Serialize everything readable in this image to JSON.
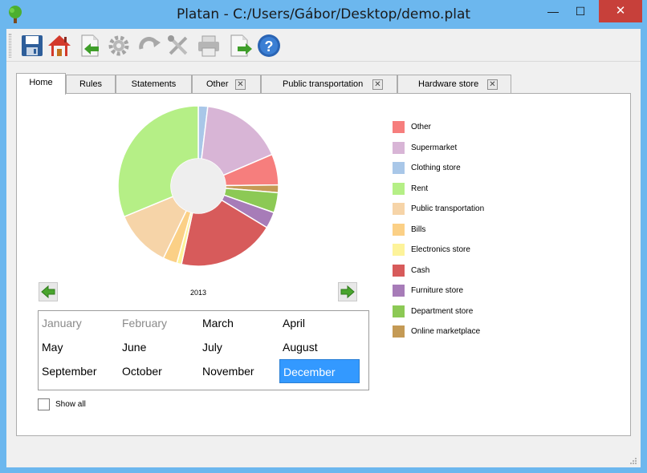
{
  "window": {
    "title": "Platan - C:/Users/Gábor/Desktop/demo.plat",
    "minimize_glyph": "—",
    "maximize_glyph": "☐",
    "close_glyph": "✕"
  },
  "toolbar": {
    "buttons": [
      {
        "name": "save-icon",
        "enabled": true
      },
      {
        "name": "home-icon",
        "enabled": true
      },
      {
        "name": "import-icon",
        "enabled": true
      },
      {
        "name": "settings-icon",
        "enabled": false
      },
      {
        "name": "redo-icon",
        "enabled": false
      },
      {
        "name": "tools-icon",
        "enabled": false
      },
      {
        "name": "print-icon",
        "enabled": false
      },
      {
        "name": "export-icon",
        "enabled": true
      },
      {
        "name": "help-icon",
        "enabled": true
      }
    ]
  },
  "tabs": [
    {
      "label": "Home",
      "active": true,
      "closable": false
    },
    {
      "label": "Rules",
      "active": false,
      "closable": false
    },
    {
      "label": "Statements",
      "active": false,
      "closable": false
    },
    {
      "label": "Other",
      "active": false,
      "closable": true
    },
    {
      "label": "Public transportation",
      "active": false,
      "closable": true
    },
    {
      "label": "Hardware store",
      "active": false,
      "closable": true
    }
  ],
  "tab_close_glyph": "✕",
  "chart_data": {
    "type": "pie",
    "subtype": "donut",
    "title": "",
    "start_angle_deg": 0,
    "direction": "clockwise",
    "slices": [
      {
        "label": "Electronics store",
        "value": 2.2,
        "color": "#a9c7e8"
      },
      {
        "label": "Supermarket",
        "value": 19.3,
        "color": "#d8b5d6"
      },
      {
        "label": "Other",
        "value": 7.2,
        "color": "#f67e7d"
      },
      {
        "label": "Online marketplace",
        "value": 1.8,
        "color": "#c49a55"
      },
      {
        "label": "Department store",
        "value": 4.7,
        "color": "#8cc955"
      },
      {
        "label": "Furniture store",
        "value": 3.8,
        "color": "#a77cb8"
      },
      {
        "label": "Cash",
        "value": 22.8,
        "color": "#d75b5b"
      },
      {
        "label": "Electronics store",
        "value": 1.1,
        "color": "#fdf39a"
      },
      {
        "label": "Bills",
        "value": 3.3,
        "color": "#fbd086"
      },
      {
        "label": "Public transportation",
        "value": 13.4,
        "color": "#f6d4a8"
      },
      {
        "label": "Rent",
        "value": 36.2,
        "color": "#b5ef86"
      }
    ],
    "hole_color": "#eeeeee"
  },
  "legend": {
    "items": [
      {
        "label": "Other",
        "color": "#f67e7d"
      },
      {
        "label": "Supermarket",
        "color": "#d8b5d6"
      },
      {
        "label": "Clothing store",
        "color": "#a9c7e8"
      },
      {
        "label": "Rent",
        "color": "#b5ef86"
      },
      {
        "label": "Public transportation",
        "color": "#f6d4a8"
      },
      {
        "label": "Bills",
        "color": "#fbd086"
      },
      {
        "label": "Electronics store",
        "color": "#fdf39a"
      },
      {
        "label": "Cash",
        "color": "#d75b5b"
      },
      {
        "label": "Furniture store",
        "color": "#a77cb8"
      },
      {
        "label": "Department store",
        "color": "#8cc955"
      },
      {
        "label": "Online marketplace",
        "color": "#c49a55"
      }
    ]
  },
  "year_nav": {
    "year": "2013"
  },
  "months": [
    {
      "label": "January",
      "state": "disabled"
    },
    {
      "label": "February",
      "state": "disabled"
    },
    {
      "label": "March",
      "state": "normal"
    },
    {
      "label": "April",
      "state": "normal"
    },
    {
      "label": "May",
      "state": "normal"
    },
    {
      "label": "June",
      "state": "normal"
    },
    {
      "label": "July",
      "state": "normal"
    },
    {
      "label": "August",
      "state": "normal"
    },
    {
      "label": "September",
      "state": "normal"
    },
    {
      "label": "October",
      "state": "normal"
    },
    {
      "label": "November",
      "state": "normal"
    },
    {
      "label": "December",
      "state": "selected"
    }
  ],
  "show_all": {
    "label": "Show all",
    "checked": false
  },
  "accent_color": "#3399ff",
  "titlebar_color": "#6cb7ee"
}
